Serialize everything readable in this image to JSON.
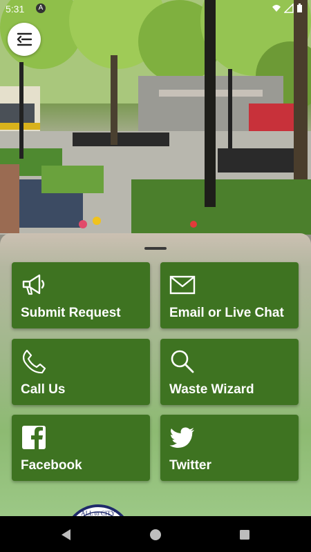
{
  "status_bar": {
    "time": "5:31",
    "app_icon": "A"
  },
  "header": {
    "menu_icon": "menu-arrow-icon"
  },
  "tiles": [
    {
      "label": "Submit Request",
      "icon": "megaphone-icon"
    },
    {
      "label": "Email or Live Chat",
      "icon": "envelope-icon"
    },
    {
      "label": "Call Us",
      "icon": "phone-icon"
    },
    {
      "label": "Waste Wizard",
      "icon": "search-icon"
    },
    {
      "label": "Facebook",
      "icon": "facebook-icon"
    },
    {
      "label": "Twitter",
      "icon": "twitter-icon"
    }
  ],
  "colors": {
    "tile_bg": "#3e7321",
    "tile_text": "#ffffff",
    "nav_bar": "#000000"
  }
}
